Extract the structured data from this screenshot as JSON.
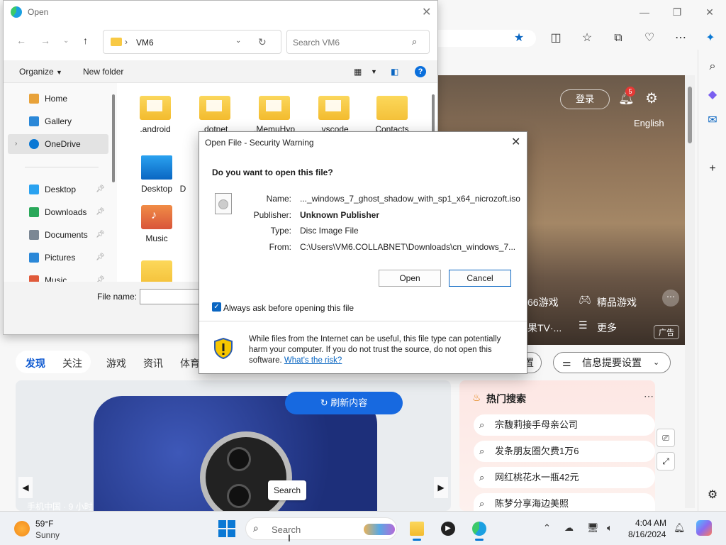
{
  "browser": {
    "hero": {
      "login_label": "登录",
      "notification_count": "5",
      "language_label": "English",
      "games_fragment": "66游戏",
      "fine_games": "精品游戏",
      "tv_fragment": "果TV·...",
      "more_label": "更多",
      "ad_label": "广告"
    },
    "feed_tabs": [
      {
        "label": "发现"
      },
      {
        "label": "关注"
      },
      {
        "label": "游戏"
      },
      {
        "label": "资讯"
      },
      {
        "label": "体育"
      }
    ],
    "feed_settings_fragment": "置",
    "info_settings_label": "信息提要设置",
    "refresh_label": "刷新内容",
    "search_chip_label": "Search",
    "card_caption": "手机中国 · 9 小时",
    "hot_search": {
      "title": "热门搜索",
      "items": [
        {
          "text": "宗馥莉接手母亲公司"
        },
        {
          "text": "发条朋友圈欠费1万6"
        },
        {
          "text": "网红桃花水一瓶42元"
        },
        {
          "text": "陈梦分享海边美照"
        }
      ]
    }
  },
  "open_dialog": {
    "title": "Open",
    "path": "VM6",
    "search_placeholder": "Search VM6",
    "organize_label": "Organize",
    "new_folder_label": "New folder",
    "nav_items": [
      {
        "label": "Home",
        "icon": "home-icon",
        "color": "#e8a23a"
      },
      {
        "label": "Gallery",
        "icon": "gallery-icon",
        "color": "#2b88d8"
      },
      {
        "label": "OneDrive",
        "icon": "cloud-icon",
        "color": "#0a78d4"
      },
      {
        "label": "Desktop",
        "icon": "desktop-icon",
        "color": "#2aa2f0"
      },
      {
        "label": "Downloads",
        "icon": "download-icon",
        "color": "#2aa85a"
      },
      {
        "label": "Documents",
        "icon": "document-icon",
        "color": "#7b8794"
      },
      {
        "label": "Pictures",
        "icon": "picture-icon",
        "color": "#2b88d8"
      },
      {
        "label": "Music",
        "icon": "music-icon",
        "color": "#e05a3a"
      }
    ],
    "files": [
      {
        "label": ".android"
      },
      {
        "label": ".dotnet"
      },
      {
        "label": ".MemuHyp"
      },
      {
        "label": ".vscode"
      },
      {
        "label": "Contacts"
      },
      {
        "label": "Desktop"
      },
      {
        "label": "D"
      },
      {
        "label": "Music"
      }
    ],
    "file_name_label": "File name:"
  },
  "security_dialog": {
    "title": "Open File - Security Warning",
    "question": "Do you want to open this file?",
    "fields": [
      {
        "label": "Name:",
        "value": "..._windows_7_ghost_shadow_with_sp1_x64_nicrozoft.iso"
      },
      {
        "label": "Publisher:",
        "value": "Unknown Publisher"
      },
      {
        "label": "Type:",
        "value": "Disc Image File"
      },
      {
        "label": "From:",
        "value": "C:\\Users\\VM6.COLLABNET\\Downloads\\cn_windows_7..."
      }
    ],
    "open_label": "Open",
    "cancel_label": "Cancel",
    "always_ask_label": "Always ask before opening this file",
    "always_ask_checked": true,
    "info_text": "While files from the Internet can be useful, this file type can potentially harm your computer. If you do not trust the source, do not open this software.",
    "risk_link": "What's the risk?"
  },
  "taskbar": {
    "weather_temp": "59°F",
    "weather_desc": "Sunny",
    "search_placeholder": "Search",
    "time": "4:04 AM",
    "date": "8/16/2024"
  },
  "colors": {
    "accent": "#0a66c2",
    "folder": "#f8c944",
    "refresh_button": "#1769e0"
  }
}
